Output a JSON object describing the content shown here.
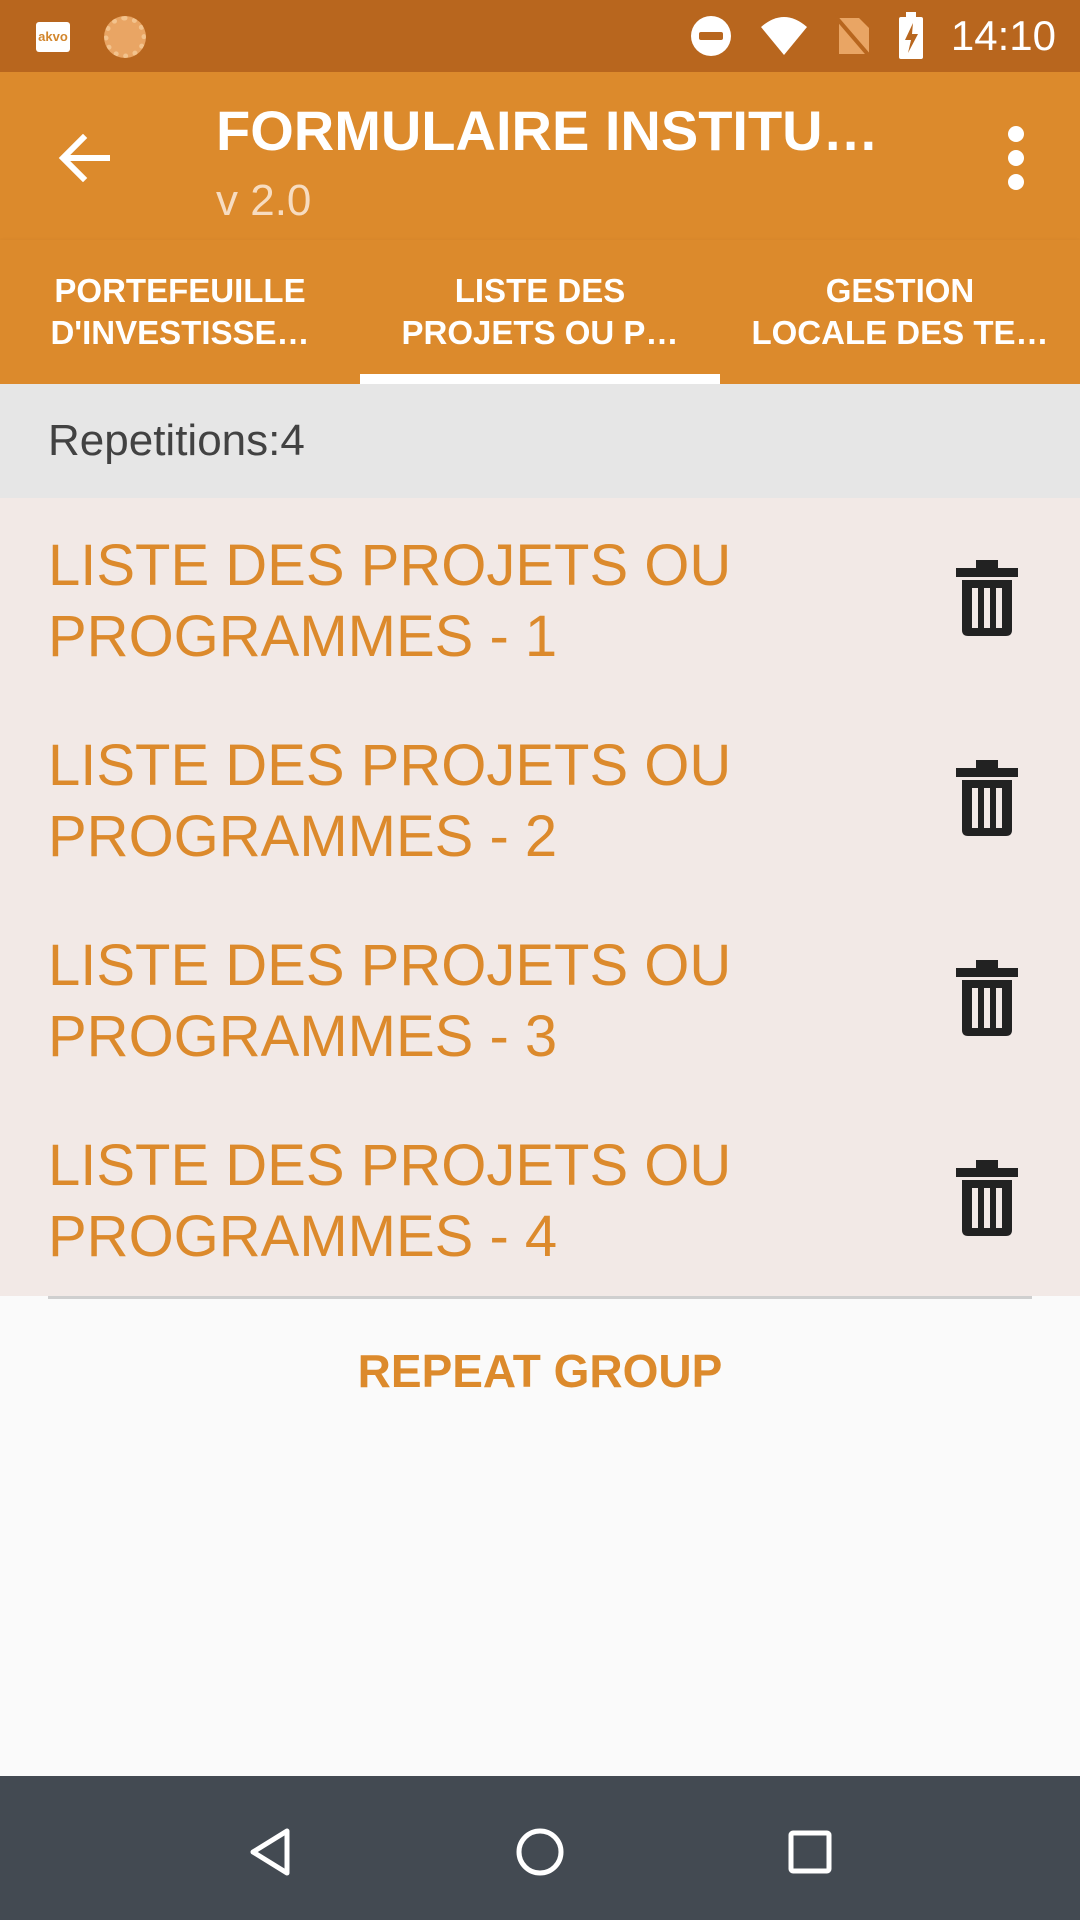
{
  "status_bar": {
    "app_badge": "akvo",
    "time": "14:10"
  },
  "app_bar": {
    "title": "FORMULAIRE INSTITU…",
    "subtitle": "v 2.0"
  },
  "tabs": [
    {
      "line1": "PORTEFEUILLE",
      "line2": "D'INVESTISSE…",
      "active": false
    },
    {
      "line1": "LISTE DES",
      "line2": "PROJETS OU P…",
      "active": true
    },
    {
      "line1": "GESTION",
      "line2": "LOCALE DES TE…",
      "active": false
    }
  ],
  "repetitions": "Repetitions:4",
  "items": [
    {
      "line1": "LISTE DES PROJETS OU",
      "line2": "PROGRAMMES - 1"
    },
    {
      "line1": "LISTE DES PROJETS OU",
      "line2": "PROGRAMMES - 2"
    },
    {
      "line1": "LISTE DES PROJETS OU",
      "line2": "PROGRAMMES - 3"
    },
    {
      "line1": "LISTE DES PROJETS OU",
      "line2": "PROGRAMMES - 4"
    }
  ],
  "repeat_button": "REPEAT GROUP",
  "colors": {
    "status_bar": "#b8661e",
    "primary": "#dc8a2c",
    "list_bg": "#f2e9e6",
    "nav_bar": "#434a52"
  }
}
